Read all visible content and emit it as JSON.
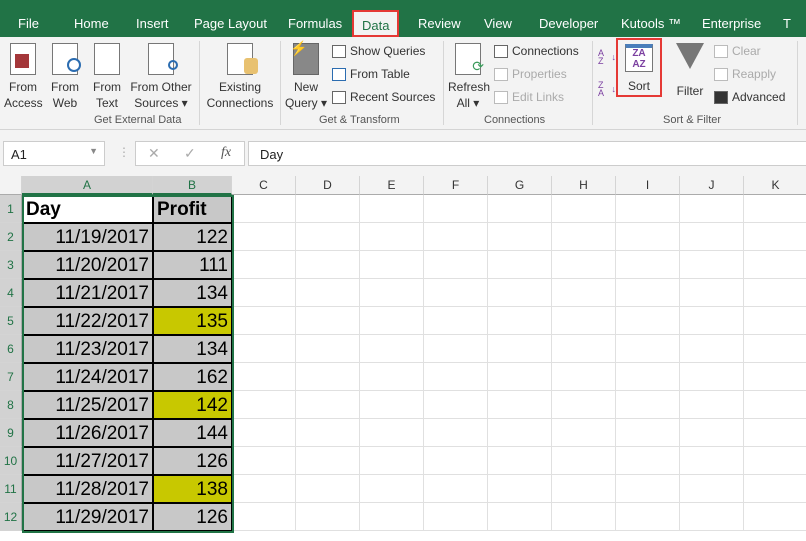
{
  "tabs": [
    "File",
    "Home",
    "Insert",
    "Page Layout",
    "Formulas",
    "Data",
    "Review",
    "View",
    "Developer",
    "Kutools ™",
    "Enterprise",
    "T"
  ],
  "active_tab": "Data",
  "ribbon": {
    "get_external": {
      "label": "Get External Data",
      "from_access": [
        "From",
        "Access"
      ],
      "from_web": [
        "From",
        "Web"
      ],
      "from_text": [
        "From",
        "Text"
      ],
      "from_other": [
        "From Other",
        "Sources ▾"
      ],
      "existing": [
        "Existing",
        "Connections"
      ]
    },
    "get_transform": {
      "label": "Get & Transform",
      "new_query": [
        "New",
        "Query ▾"
      ],
      "show_queries": "Show Queries",
      "from_table": "From Table",
      "recent_sources": "Recent Sources"
    },
    "connections": {
      "label": "Connections",
      "refresh": [
        "Refresh",
        "All ▾"
      ],
      "connections": "Connections",
      "properties": "Properties",
      "edit_links": "Edit Links"
    },
    "sort_filter": {
      "label": "Sort & Filter",
      "sort": "Sort",
      "filter": "Filter",
      "clear": "Clear",
      "reapply": "Reapply",
      "advanced": "Advanced",
      "sort_az": "A Z",
      "sort_za": "Z A"
    }
  },
  "formula_bar": {
    "name_box": "A1",
    "value": "Day",
    "fx": "fx"
  },
  "columns": [
    "A",
    "B",
    "C",
    "D",
    "E",
    "F",
    "G",
    "H",
    "I",
    "J",
    "K"
  ],
  "rows": [
    "1",
    "2",
    "3",
    "4",
    "5",
    "6",
    "7",
    "8",
    "9",
    "10",
    "11",
    "12"
  ],
  "table": {
    "headers": [
      "Day",
      "Profit"
    ],
    "data": [
      [
        "11/19/2017",
        "122"
      ],
      [
        "11/20/2017",
        "111"
      ],
      [
        "11/21/2017",
        "134"
      ],
      [
        "11/22/2017",
        "135"
      ],
      [
        "11/23/2017",
        "134"
      ],
      [
        "11/24/2017",
        "162"
      ],
      [
        "11/25/2017",
        "142"
      ],
      [
        "11/26/2017",
        "144"
      ],
      [
        "11/27/2017",
        "126"
      ],
      [
        "11/28/2017",
        "138"
      ],
      [
        "11/29/2017",
        "126"
      ]
    ],
    "highlighted_rows": [
      3,
      6,
      9
    ]
  },
  "colors": {
    "brand": "#217346",
    "highlight": "#c8c800",
    "cell_fill": "#c8c8c8",
    "callout": "#e53935"
  }
}
